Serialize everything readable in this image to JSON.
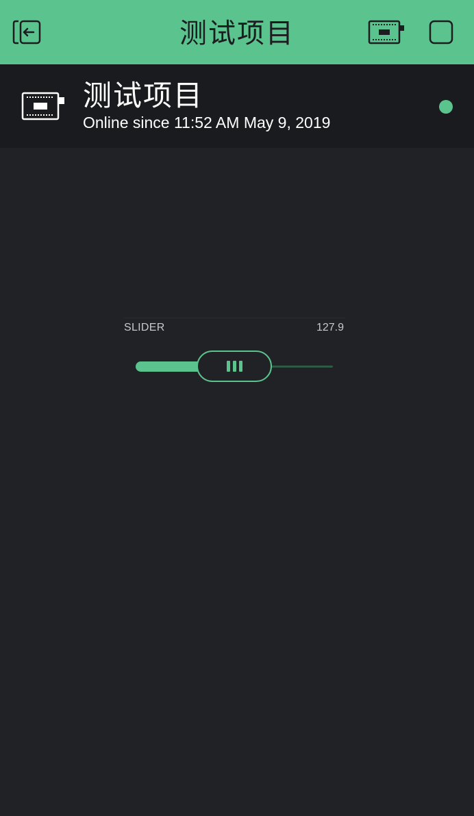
{
  "topbar": {
    "title": "测试项目",
    "back_icon": "exit-icon",
    "device_icon": "device-board-icon",
    "stop_icon": "stop-icon"
  },
  "device": {
    "name": "测试项目",
    "status": "Online since 11:52 AM May 9, 2019",
    "icon": "device-board-icon",
    "online": true
  },
  "slider": {
    "label": "SLIDER",
    "value": "127.9",
    "fill_fraction": 0.5
  },
  "colors": {
    "accent": "#5bc48e",
    "background": "#212226",
    "header": "#1a1b1e"
  }
}
